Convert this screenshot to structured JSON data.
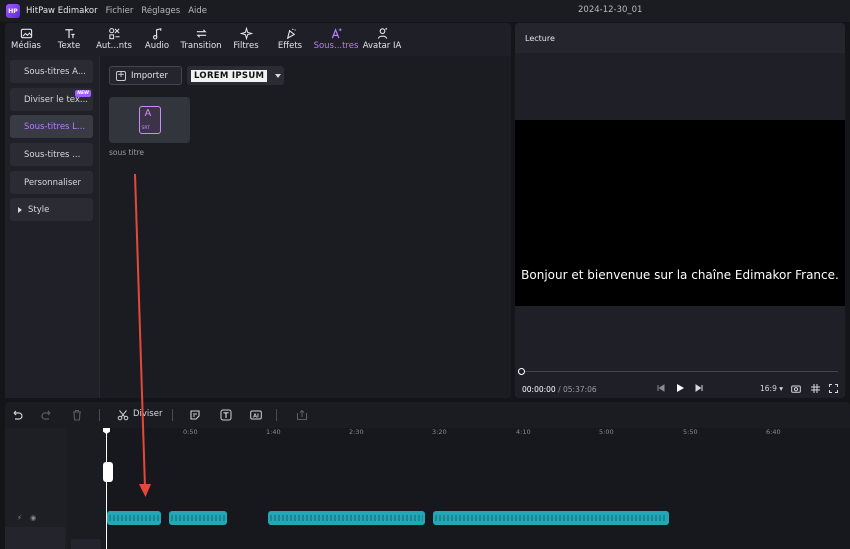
{
  "app": {
    "name": "HitPaw Edimakor",
    "project_title": "2024-12-30_01"
  },
  "menu": [
    "Fichier",
    "Réglages",
    "Aide"
  ],
  "toolbar": [
    {
      "label": "Médias",
      "icon": "media-icon"
    },
    {
      "label": "Texte",
      "icon": "text-icon"
    },
    {
      "label": "Aut...nts",
      "icon": "auto-icon"
    },
    {
      "label": "Audio",
      "icon": "audio-icon"
    },
    {
      "label": "Transition",
      "icon": "transition-icon"
    },
    {
      "label": "Filtres",
      "icon": "filter-icon"
    },
    {
      "label": "Effets",
      "icon": "effects-icon"
    },
    {
      "label": "Sous...tres",
      "icon": "subtitle-icon",
      "active": true
    },
    {
      "label": "Avatar IA",
      "icon": "avatar-icon"
    }
  ],
  "sidebar": {
    "items": [
      {
        "label": "Sous-titres A..."
      },
      {
        "label": "Diviser le tex...",
        "badge": "NEW"
      },
      {
        "label": "Sous-titres L...",
        "active": true
      },
      {
        "label": "Sous-titres ..."
      },
      {
        "label": "Personnaliser"
      },
      {
        "label": "Style"
      }
    ]
  },
  "content": {
    "import_label": "Importer",
    "style_preview": "LOREM IPSUM",
    "media_items": [
      {
        "name": "sous titre",
        "type": "SRT",
        "glyph": "A"
      }
    ]
  },
  "preview": {
    "header": "Lecture",
    "subtitle_text": "Bonjour et bienvenue sur la chaîne Edimakor France.",
    "current_time": "00:00:00",
    "separator": "/",
    "duration": "05:37:06",
    "aspect_ratio": "16:9"
  },
  "timeline": {
    "divide_label": "Diviser",
    "ruler_ticks": [
      "0:50",
      "1:40",
      "2:30",
      "3:20",
      "4:10",
      "5:00",
      "5:50",
      "6:40"
    ]
  },
  "colors": {
    "accent": "#b77cff",
    "clip": "#23a7b4",
    "annotation": "#e5483a"
  }
}
